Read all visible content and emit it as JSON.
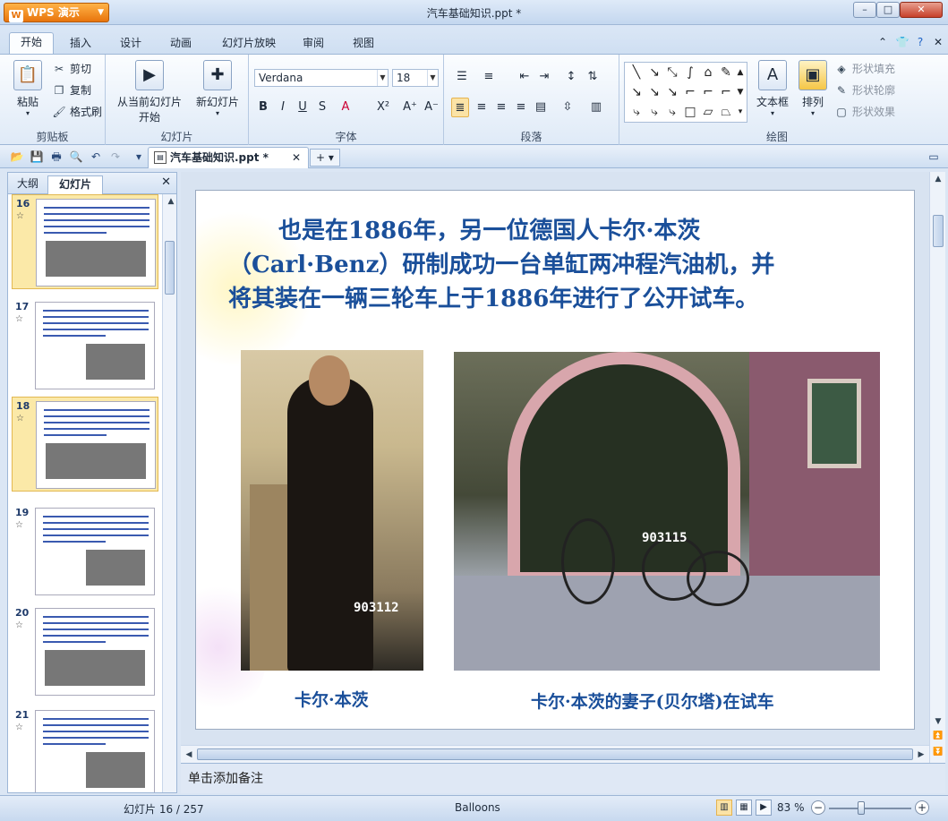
{
  "app": {
    "name": "WPS 演示",
    "doc_title": "汽车基础知识.ppt *"
  },
  "window": {
    "min": "–",
    "max": "□",
    "close": "✕"
  },
  "tabs": [
    {
      "label": "开始",
      "active": true
    },
    {
      "label": "插入"
    },
    {
      "label": "设计"
    },
    {
      "label": "动画"
    },
    {
      "label": "幻灯片放映"
    },
    {
      "label": "审阅"
    },
    {
      "label": "视图"
    }
  ],
  "ribbon": {
    "clipboard": {
      "paste": "粘贴",
      "cut": "剪切",
      "copy": "复制",
      "format_painter": "格式刷",
      "label": "剪贴板"
    },
    "slides": {
      "from_current": "从当前幻灯片",
      "start": "开始",
      "new_slide": "新幻灯片",
      "label": "幻灯片"
    },
    "font": {
      "family": "Verdana",
      "size": "18",
      "label": "字体",
      "bold": "B",
      "italic": "I",
      "underline": "U",
      "shadow": "S",
      "color": "A",
      "superscript": "X²",
      "grow": "A⁺",
      "shrink": "A⁻"
    },
    "paragraph": {
      "label": "段落"
    },
    "drawing": {
      "textbox": "文本框",
      "arrange": "排列",
      "fill": "形状填充",
      "outline": "形状轮廓",
      "effect": "形状效果",
      "label": "绘图"
    }
  },
  "document_tab": {
    "label": "汽车基础知识.ppt *",
    "close": "✕",
    "new": "+"
  },
  "panel": {
    "tab_outline": "大纲",
    "tab_slides": "幻灯片",
    "close": "✕"
  },
  "thumbnails": [
    {
      "num": "16",
      "selected": true
    },
    {
      "num": "17"
    },
    {
      "num": "18",
      "selected": true
    },
    {
      "num": "19"
    },
    {
      "num": "20"
    },
    {
      "num": "21"
    }
  ],
  "slide": {
    "line1": "也是在1886年，另一位德国人卡尔·本茨",
    "line2": "（Carl·Benz）研制成功一台单缸两冲程汽油机，并",
    "line3": "将其装在一辆三轮车上于1886年进行了公开试车。",
    "photo1_num": "903112",
    "photo2_num": "903115",
    "caption1": "卡尔·本茨",
    "caption2": "卡尔·本茨的妻子(贝尔塔)在试车"
  },
  "notes_placeholder": "单击添加备注",
  "status": {
    "slide_info": "幻灯片 16 / 257",
    "theme": "Balloons",
    "zoom": "83 %"
  }
}
